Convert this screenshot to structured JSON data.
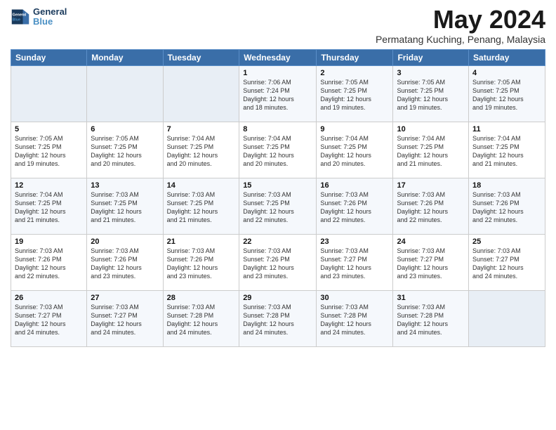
{
  "header": {
    "logo_line1": "General",
    "logo_line2": "Blue",
    "month_title": "May 2024",
    "location": "Permatang Kuching, Penang, Malaysia"
  },
  "days_of_week": [
    "Sunday",
    "Monday",
    "Tuesday",
    "Wednesday",
    "Thursday",
    "Friday",
    "Saturday"
  ],
  "weeks": [
    [
      {
        "day": "",
        "info": ""
      },
      {
        "day": "",
        "info": ""
      },
      {
        "day": "",
        "info": ""
      },
      {
        "day": "1",
        "info": "Sunrise: 7:06 AM\nSunset: 7:24 PM\nDaylight: 12 hours\nand 18 minutes."
      },
      {
        "day": "2",
        "info": "Sunrise: 7:05 AM\nSunset: 7:25 PM\nDaylight: 12 hours\nand 19 minutes."
      },
      {
        "day": "3",
        "info": "Sunrise: 7:05 AM\nSunset: 7:25 PM\nDaylight: 12 hours\nand 19 minutes."
      },
      {
        "day": "4",
        "info": "Sunrise: 7:05 AM\nSunset: 7:25 PM\nDaylight: 12 hours\nand 19 minutes."
      }
    ],
    [
      {
        "day": "5",
        "info": "Sunrise: 7:05 AM\nSunset: 7:25 PM\nDaylight: 12 hours\nand 19 minutes."
      },
      {
        "day": "6",
        "info": "Sunrise: 7:05 AM\nSunset: 7:25 PM\nDaylight: 12 hours\nand 20 minutes."
      },
      {
        "day": "7",
        "info": "Sunrise: 7:04 AM\nSunset: 7:25 PM\nDaylight: 12 hours\nand 20 minutes."
      },
      {
        "day": "8",
        "info": "Sunrise: 7:04 AM\nSunset: 7:25 PM\nDaylight: 12 hours\nand 20 minutes."
      },
      {
        "day": "9",
        "info": "Sunrise: 7:04 AM\nSunset: 7:25 PM\nDaylight: 12 hours\nand 20 minutes."
      },
      {
        "day": "10",
        "info": "Sunrise: 7:04 AM\nSunset: 7:25 PM\nDaylight: 12 hours\nand 21 minutes."
      },
      {
        "day": "11",
        "info": "Sunrise: 7:04 AM\nSunset: 7:25 PM\nDaylight: 12 hours\nand 21 minutes."
      }
    ],
    [
      {
        "day": "12",
        "info": "Sunrise: 7:04 AM\nSunset: 7:25 PM\nDaylight: 12 hours\nand 21 minutes."
      },
      {
        "day": "13",
        "info": "Sunrise: 7:03 AM\nSunset: 7:25 PM\nDaylight: 12 hours\nand 21 minutes."
      },
      {
        "day": "14",
        "info": "Sunrise: 7:03 AM\nSunset: 7:25 PM\nDaylight: 12 hours\nand 21 minutes."
      },
      {
        "day": "15",
        "info": "Sunrise: 7:03 AM\nSunset: 7:25 PM\nDaylight: 12 hours\nand 22 minutes."
      },
      {
        "day": "16",
        "info": "Sunrise: 7:03 AM\nSunset: 7:26 PM\nDaylight: 12 hours\nand 22 minutes."
      },
      {
        "day": "17",
        "info": "Sunrise: 7:03 AM\nSunset: 7:26 PM\nDaylight: 12 hours\nand 22 minutes."
      },
      {
        "day": "18",
        "info": "Sunrise: 7:03 AM\nSunset: 7:26 PM\nDaylight: 12 hours\nand 22 minutes."
      }
    ],
    [
      {
        "day": "19",
        "info": "Sunrise: 7:03 AM\nSunset: 7:26 PM\nDaylight: 12 hours\nand 22 minutes."
      },
      {
        "day": "20",
        "info": "Sunrise: 7:03 AM\nSunset: 7:26 PM\nDaylight: 12 hours\nand 23 minutes."
      },
      {
        "day": "21",
        "info": "Sunrise: 7:03 AM\nSunset: 7:26 PM\nDaylight: 12 hours\nand 23 minutes."
      },
      {
        "day": "22",
        "info": "Sunrise: 7:03 AM\nSunset: 7:26 PM\nDaylight: 12 hours\nand 23 minutes."
      },
      {
        "day": "23",
        "info": "Sunrise: 7:03 AM\nSunset: 7:27 PM\nDaylight: 12 hours\nand 23 minutes."
      },
      {
        "day": "24",
        "info": "Sunrise: 7:03 AM\nSunset: 7:27 PM\nDaylight: 12 hours\nand 23 minutes."
      },
      {
        "day": "25",
        "info": "Sunrise: 7:03 AM\nSunset: 7:27 PM\nDaylight: 12 hours\nand 24 minutes."
      }
    ],
    [
      {
        "day": "26",
        "info": "Sunrise: 7:03 AM\nSunset: 7:27 PM\nDaylight: 12 hours\nand 24 minutes."
      },
      {
        "day": "27",
        "info": "Sunrise: 7:03 AM\nSunset: 7:27 PM\nDaylight: 12 hours\nand 24 minutes."
      },
      {
        "day": "28",
        "info": "Sunrise: 7:03 AM\nSunset: 7:28 PM\nDaylight: 12 hours\nand 24 minutes."
      },
      {
        "day": "29",
        "info": "Sunrise: 7:03 AM\nSunset: 7:28 PM\nDaylight: 12 hours\nand 24 minutes."
      },
      {
        "day": "30",
        "info": "Sunrise: 7:03 AM\nSunset: 7:28 PM\nDaylight: 12 hours\nand 24 minutes."
      },
      {
        "day": "31",
        "info": "Sunrise: 7:03 AM\nSunset: 7:28 PM\nDaylight: 12 hours\nand 24 minutes."
      },
      {
        "day": "",
        "info": ""
      }
    ]
  ]
}
